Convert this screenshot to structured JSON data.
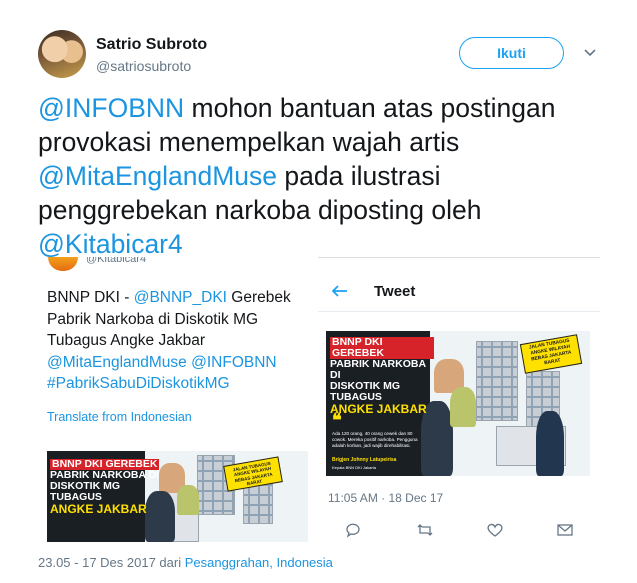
{
  "user": {
    "name": "Satrio Subroto",
    "handle": "@satriosubroto"
  },
  "follow_label": "Ikuti",
  "tweet": {
    "m1": "@INFOBNN",
    "t1": " mohon bantuan atas postingan provokasi menempelkan wajah artis ",
    "m2": "@MitaEnglandMuse",
    "t2": " pada ilustrasi penggrebekan narkoba diposting oleh ",
    "m3": "@Kitabicar4"
  },
  "quoted": {
    "handle": "@Kitabicar4",
    "t1": "BNNP DKI - ",
    "m1": "@BNNP_DKI",
    "t2": " Gerebek Pabrik Narkoba di Diskotik MG Tubagus Angke Jakbar ",
    "m2": "@MitaEnglandMuse",
    "m3": "@INFOBNN",
    "m4": "#PabrikSabuDiDiskotikMG",
    "translate": "Translate from Indonesian",
    "poster": {
      "line1": "BNNP DKI GEREBEK",
      "line2": "PABRIK NARKOBA DI",
      "line3": "DISKOTIK MG TUBAGUS",
      "line4": "ANGKE JAKBAR",
      "sign": "JALAN TUBAGUS ANGKE WILAYAH BEBAS JAKARTA BARAT"
    }
  },
  "screenshot": {
    "title": "Tweet",
    "time": "11:05 AM · 18 Dec 17",
    "poster": {
      "line1": "BNNP DKI GEREBEK",
      "line2": "PABRIK NARKOBA DI",
      "line3": "DISKOTIK MG TUBAGUS",
      "line4": "ANGKE JAKBAR",
      "sign": "JALAN TUBAGUS ANGKE WILAYAH BEBAS JAKARTA BARAT",
      "quote": "Ada 120 orang, 40 orang cewek dan 80 cowok. Mereka positif narkoba. Pengguna adalah korban, jadi wajib direhabilitasi.",
      "attribution": "Brigjen Johnny Latupeirisa",
      "attribution_role": "Kepala BNN DKI Jakarta"
    }
  },
  "footer": {
    "timestamp": "23.05 - 17 Des 2017 dari ",
    "location": "Pesanggrahan, Indonesia"
  },
  "icons": {
    "caret": "chevron-down-icon",
    "back": "back-arrow-icon",
    "reply": "reply-icon",
    "retweet": "retweet-icon",
    "like": "heart-icon",
    "dm": "envelope-icon"
  },
  "colors": {
    "link": "#1b95e0",
    "accent": "#1da1f2",
    "muted": "#657786",
    "poster_red": "#d6232a",
    "poster_yellow": "#ffe100"
  }
}
